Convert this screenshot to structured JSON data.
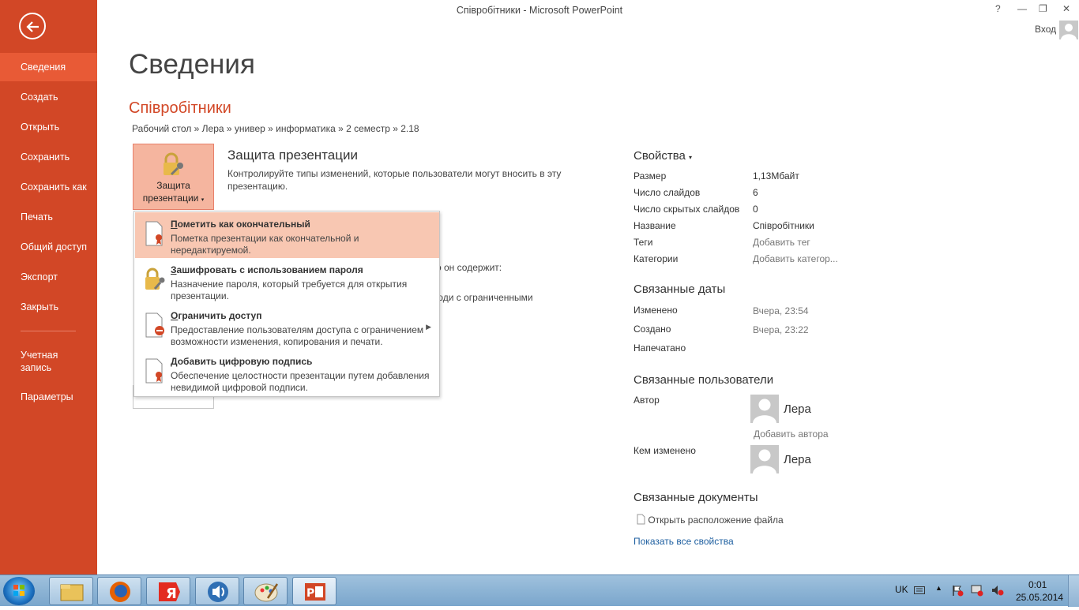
{
  "window": {
    "title": "Співробітники - Microsoft PowerPoint",
    "help": "?",
    "minimize": "—",
    "restore": "❐",
    "close": "✕",
    "signin": "Вход"
  },
  "sidebar": {
    "items": [
      {
        "label": "Сведения"
      },
      {
        "label": "Создать"
      },
      {
        "label": "Открыть"
      },
      {
        "label": "Сохранить"
      },
      {
        "label": "Сохранить как"
      },
      {
        "label": "Печать"
      },
      {
        "label": "Общий доступ"
      },
      {
        "label": "Экспорт"
      },
      {
        "label": "Закрыть"
      }
    ],
    "account_line1": "Учетная",
    "account_line2": "запись",
    "options": "Параметры"
  },
  "page": {
    "title": "Сведения",
    "doc_name": "Співробітники",
    "breadcrumb": "Рабочий стол » Лера » универ » информатика » 2 семестр » 2.18"
  },
  "protect": {
    "button_line1": "Защита",
    "button_line2": "презентации",
    "title": "Защита презентации",
    "desc": "Контролируйте типы изменений, которые пользователи могут вносить в эту презентацию.",
    "frag1": "о он содержит:",
    "frag2": "юди с ограниченными"
  },
  "menu": {
    "items": [
      {
        "title_key": "П",
        "title_rest": "ометить как окончательный",
        "desc": "Пометка презентации как окончательной и нередактируемой."
      },
      {
        "title_key": "З",
        "title_rest": "ашифровать с использованием пароля",
        "desc": "Назначение пароля, который требуется для открытия презентации."
      },
      {
        "title_key": "О",
        "title_rest": "граничить доступ",
        "desc": "Предоставление пользователям доступа с ограничением возможности изменения, копирования и печати."
      },
      {
        "title_key": "Д",
        "title_rest": "обавить цифровую подпись",
        "desc": "Обеспечение целостности презентации путем добавления невидимой цифровой подписи."
      }
    ]
  },
  "properties": {
    "header": "Свойства",
    "rows": [
      {
        "label": "Размер",
        "value": "1,13Мбайт"
      },
      {
        "label": "Число слайдов",
        "value": "6"
      },
      {
        "label": "Число скрытых слайдов",
        "value": "0"
      },
      {
        "label": "Название",
        "value": "Співробітники"
      },
      {
        "label": "Теги",
        "value": "Добавить тег"
      },
      {
        "label": "Категории",
        "value": "Добавить категор..."
      }
    ]
  },
  "dates": {
    "header": "Связанные даты",
    "modified_label": "Изменено",
    "modified": "Вчера, 23:54",
    "created_label": "Создано",
    "created": "Вчера, 23:22",
    "printed_label": "Напечатано"
  },
  "people": {
    "header": "Связанные пользователи",
    "author_label": "Автор",
    "author": "Лера",
    "add_author": "Добавить автора",
    "modified_by_label": "Кем изменено",
    "modified_by": "Лера"
  },
  "docs": {
    "header": "Связанные документы",
    "open_location": "Открыть расположение файла",
    "show_all": "Показать все свойства"
  },
  "taskbar": {
    "lang": "UK",
    "time": "0:01",
    "date": "25.05.2014"
  },
  "colors": {
    "accent": "#d24726",
    "sidebar_active": "#e85a36",
    "menu_highlight": "#f8c7b2",
    "link": "#1e5fa0"
  }
}
